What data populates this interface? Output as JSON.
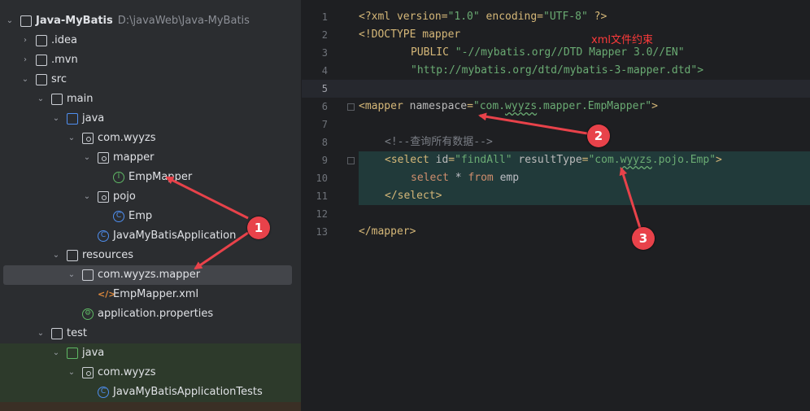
{
  "project": {
    "name": "Java-MyBatis",
    "path": "D:\\javaWeb\\Java-MyBatis"
  },
  "tree": [
    {
      "label": ".idea"
    },
    {
      "label": ".mvn"
    },
    {
      "label": "src"
    },
    {
      "label": "main"
    },
    {
      "label": "java"
    },
    {
      "label": "com.wyyzs"
    },
    {
      "label": "mapper"
    },
    {
      "label": "EmpMapper"
    },
    {
      "label": "pojo"
    },
    {
      "label": "Emp"
    },
    {
      "label": "JavaMyBatisApplication"
    },
    {
      "label": "resources"
    },
    {
      "label": "com.wyyzs.mapper"
    },
    {
      "label": "EmpMapper.xml"
    },
    {
      "label": "application.properties"
    },
    {
      "label": "test"
    },
    {
      "label": "java"
    },
    {
      "label": "com.wyyzs"
    },
    {
      "label": "JavaMyBatisApplicationTests"
    }
  ],
  "editor": {
    "line_numbers": [
      "1",
      "2",
      "3",
      "4",
      "5",
      "6",
      "7",
      "8",
      "9",
      "10",
      "11",
      "12",
      "13"
    ],
    "current_line": "5",
    "code": {
      "l1_a": "<?xml version=",
      "l1_b": "\"1.0\"",
      "l1_c": " encoding=",
      "l1_d": "\"UTF-8\"",
      "l1_e": " ?>",
      "l2": "<!DOCTYPE mapper",
      "l3_a": "PUBLIC ",
      "l3_b": "\"-//mybatis.org//DTD Mapper 3.0//EN\"",
      "l4": "\"http://mybatis.org/dtd/mybatis-3-mapper.dtd\">",
      "l6_a": "<mapper ",
      "l6_b": "namespace",
      "l6_c": "=",
      "l6_d": "\"com.",
      "l6_e": "wyyzs",
      "l6_f": ".mapper.EmpMapper\"",
      "l6_g": ">",
      "l8": "<!--查询所有数据-->",
      "l9_a": "<select ",
      "l9_b": "id",
      "l9_c": "=",
      "l9_d": "\"findAll\"",
      "l9_e": " resultType",
      "l9_f": "=",
      "l9_g": "\"com.",
      "l9_h": "wyyzs",
      "l9_i": ".pojo.Emp\"",
      "l9_j": ">",
      "l10_a": "select",
      "l10_b": " * ",
      "l10_c": "from",
      "l10_d": " emp",
      "l11": "</select>",
      "l13": "</mapper>"
    }
  },
  "annotations": {
    "note": "xml文件约束",
    "badge1": "1",
    "badge2": "2",
    "badge3": "3"
  },
  "colors": {
    "accent_red": "#e8424a"
  }
}
